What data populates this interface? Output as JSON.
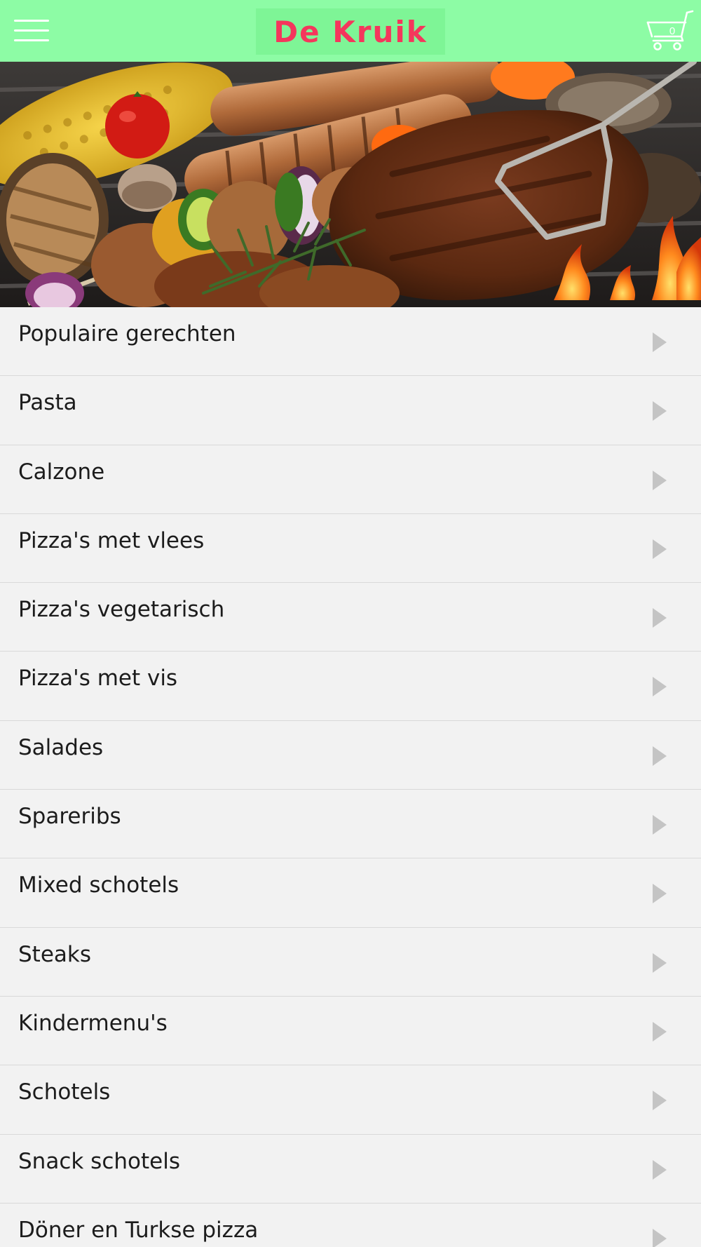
{
  "header": {
    "menu_icon": "hamburger-menu-icon",
    "logo_text": "De Kruik",
    "cart": {
      "icon": "shopping-cart-icon",
      "count": "0"
    },
    "colors": {
      "bar": "#8dfca5",
      "logo": "#f5365c",
      "icons": "#ffffff"
    }
  },
  "hero": {
    "icon": "hero-photo-grilled-meat"
  },
  "categories": [
    {
      "label": "Populaire gerechten"
    },
    {
      "label": "Pasta"
    },
    {
      "label": "Calzone"
    },
    {
      "label": "Pizza's met vlees"
    },
    {
      "label": "Pizza's vegetarisch"
    },
    {
      "label": "Pizza's met vis"
    },
    {
      "label": "Salades"
    },
    {
      "label": "Spareribs"
    },
    {
      "label": "Mixed schotels"
    },
    {
      "label": "Steaks"
    },
    {
      "label": "Kindermenu's"
    },
    {
      "label": "Schotels"
    },
    {
      "label": "Snack schotels"
    },
    {
      "label": "Döner en Turkse pizza"
    }
  ],
  "row_icon": "chevron-right-icon"
}
